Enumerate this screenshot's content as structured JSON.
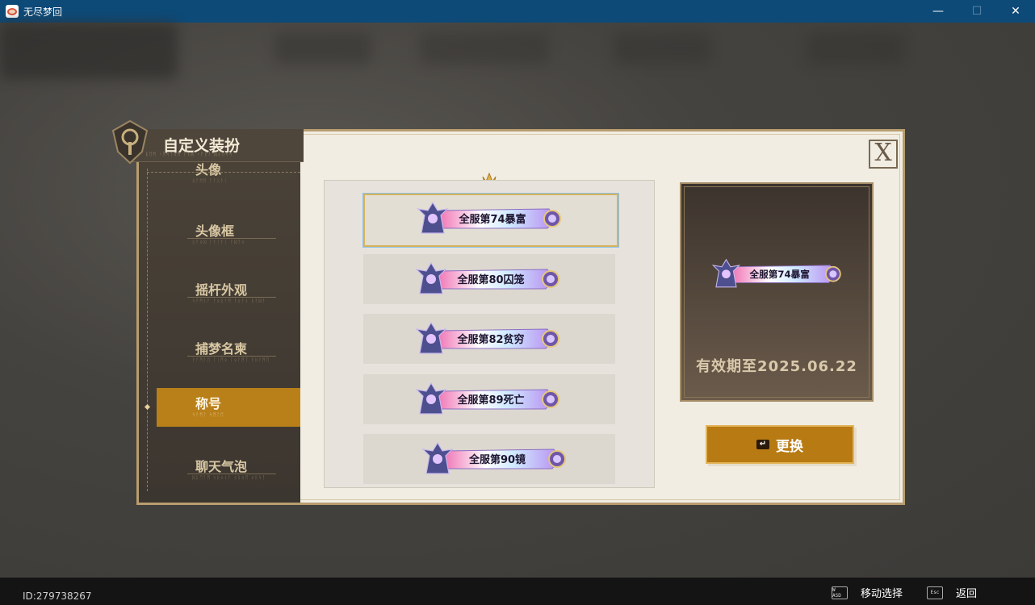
{
  "window": {
    "title": "无尽梦回",
    "controls": {
      "minimize": "—",
      "maximize": "☐",
      "close": "✕"
    }
  },
  "dialog": {
    "title": "自定义装扮",
    "title_sub": "ᚱᛖᛗ ᚲᚢᛋᛏᛟᛗ ᚨᚾᛞ ᚲᚨᚱᚨ ᛞᚱᛖᛋᛋ",
    "close_label": "X",
    "nav": [
      {
        "label": "头像",
        "sub": "ᚺᚨᛗᛗ ᛚᚨᚷᚨᛁ",
        "active": false
      },
      {
        "label": "头像框",
        "sub": "ᚷᚨᛟᛞ ᛚᚨᛁᚨᛁ ᚨᛞᛏᛟ",
        "active": false
      },
      {
        "label": "摇杆外观",
        "sub": "ᛋᚨᛗᚾᚨ ᚨᛟᚱᚨᛗ ᚨᛟᚨᚾ ᚱᚨᛞᚨ",
        "active": false
      },
      {
        "label": "捕梦名柬",
        "sub": "ᚹᚨᛗᚨᛖ ᛚᛁᛗᛟ ᛚᛟᚨᛗᛏ ᚹᚺᚨᛗᛖ",
        "active": false
      },
      {
        "label": "称号",
        "sub": "ᛋᚨᛗᛚ ᛋᛗᛚᛖ",
        "active": true
      },
      {
        "label": "聊天气泡",
        "sub": "ᛞᚱᛖᚨᛗ ᛋᚺᛟᚾᚨ ᛟᚱᛟᛖ ᛟᚱᛋᚨ",
        "active": false
      }
    ],
    "titles": [
      {
        "text": "全服第74暴富",
        "selected": true
      },
      {
        "text": "全服第80囚笼",
        "selected": false
      },
      {
        "text": "全服第82贫穷",
        "selected": false
      },
      {
        "text": "全服第89死亡",
        "selected": false
      },
      {
        "text": "全服第90镜",
        "selected": false
      }
    ],
    "preview": {
      "title": "全服第74暴富",
      "validity": "有效期至2025.06.22"
    },
    "change_button": "更换",
    "change_icon": "↵"
  },
  "bottom": {
    "uid": "ID:279738267",
    "hints": [
      {
        "key": "W ASD",
        "label": "移动选择"
      },
      {
        "key": "Esc",
        "label": "返回"
      }
    ]
  },
  "colors": {
    "accent": "#b9801a",
    "titlebar": "#0d4a78"
  }
}
